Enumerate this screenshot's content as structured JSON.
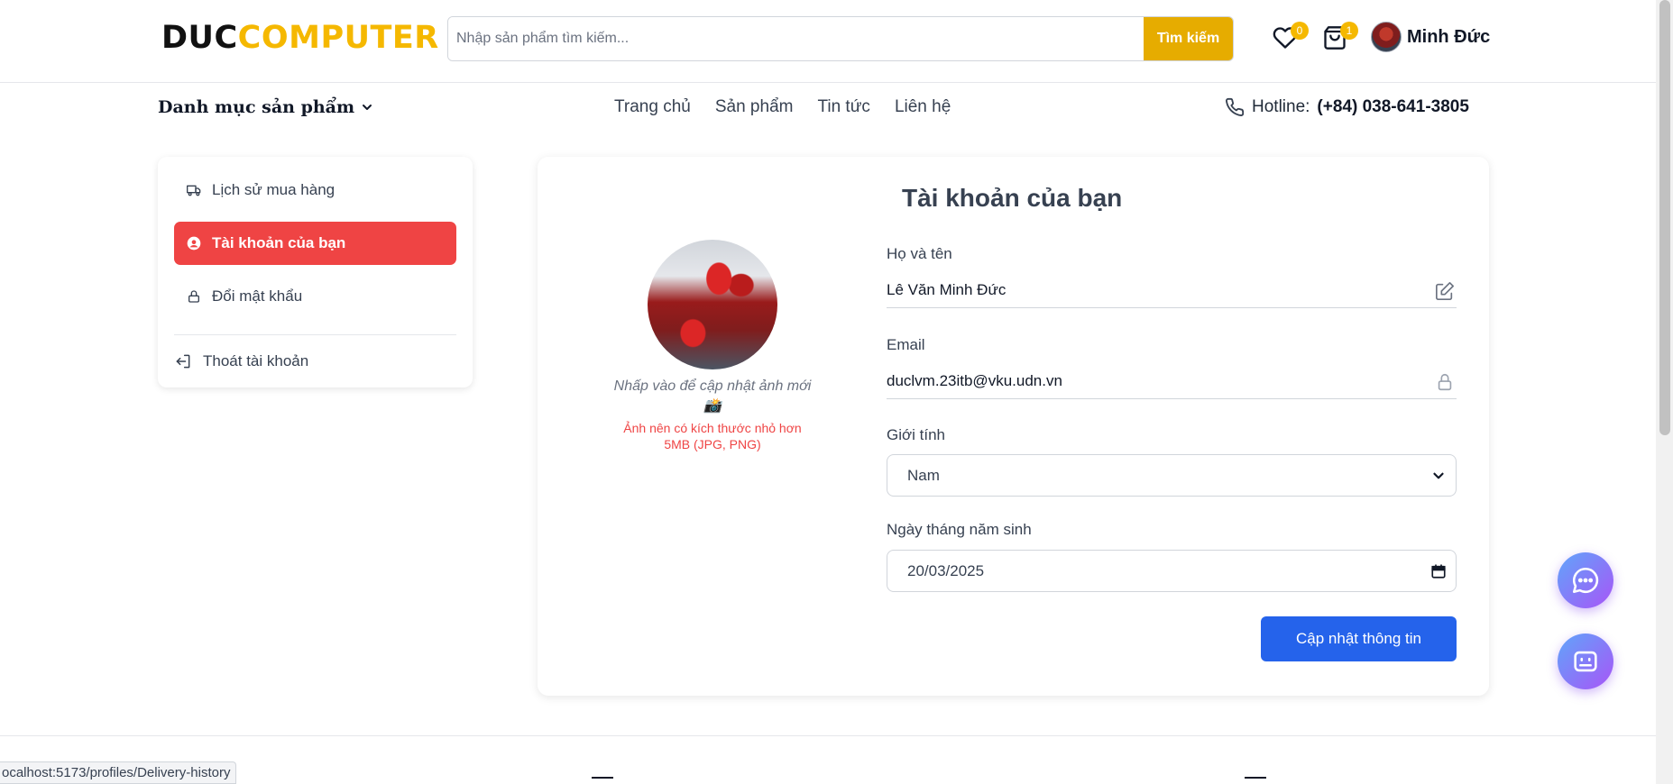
{
  "header": {
    "logo_part1": "DUC",
    "logo_part2": "COMPUTER",
    "search_placeholder": "Nhập sản phẩm tìm kiếm...",
    "search_button": "Tìm kiếm",
    "wishlist_count": "0",
    "cart_count": "1",
    "user_name": "Minh Đức"
  },
  "nav": {
    "categories_label": "Danh mục sản phẩm",
    "links": [
      "Trang chủ",
      "Sản phẩm",
      "Tin tức",
      "Liên hệ"
    ],
    "hotline_label": "Hotline:",
    "hotline_number": "(+84) 038-641-3805"
  },
  "sidebar": {
    "items": [
      {
        "label": "Lịch sử mua hàng",
        "icon": "truck-icon",
        "active": false
      },
      {
        "label": "Tài khoản của bạn",
        "icon": "user-circle-icon",
        "active": true
      },
      {
        "label": "Đổi mật khẩu",
        "icon": "lock-icon",
        "active": false
      }
    ],
    "logout_label": "Thoát tài khoản"
  },
  "profile": {
    "title": "Tài khoản của bạn",
    "avatar_note": "Nhấp vào để cập nhật ảnh mới 📸",
    "avatar_warning": "Ảnh nên có kích thước nhỏ hơn 5MB (JPG, PNG)",
    "fullname_label": "Họ và tên",
    "fullname_value": "Lê Văn Minh Đức",
    "email_label": "Email",
    "email_value": "duclvm.23itb@vku.udn.vn",
    "gender_label": "Giới tính",
    "gender_value": "Nam",
    "dob_label": "Ngày tháng năm sinh",
    "dob_value": "20/03/2025",
    "update_button": "Cập nhật thông tin"
  },
  "status_bar": {
    "url": "ocalhost:5173/profiles/Delivery-history"
  },
  "colors": {
    "brand_yellow": "#f5b800",
    "active_red": "#ef4444",
    "primary_blue": "#2563eb"
  }
}
